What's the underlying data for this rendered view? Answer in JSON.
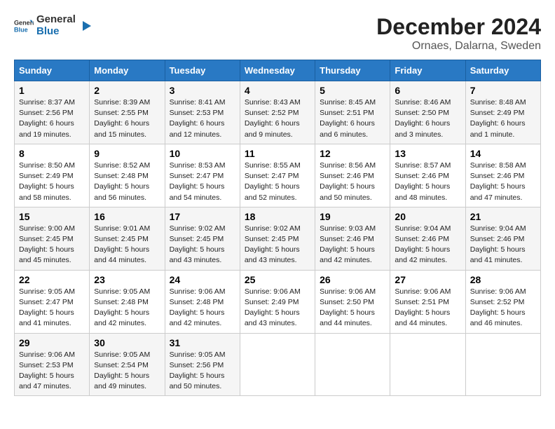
{
  "header": {
    "logo_general": "General",
    "logo_blue": "Blue",
    "title": "December 2024",
    "subtitle": "Ornaes, Dalarna, Sweden"
  },
  "days_of_week": [
    "Sunday",
    "Monday",
    "Tuesday",
    "Wednesday",
    "Thursday",
    "Friday",
    "Saturday"
  ],
  "weeks": [
    [
      {
        "num": "1",
        "sr": "8:37 AM",
        "ss": "2:56 PM",
        "dl": "6 hours and 19 minutes."
      },
      {
        "num": "2",
        "sr": "8:39 AM",
        "ss": "2:55 PM",
        "dl": "6 hours and 15 minutes."
      },
      {
        "num": "3",
        "sr": "8:41 AM",
        "ss": "2:53 PM",
        "dl": "6 hours and 12 minutes."
      },
      {
        "num": "4",
        "sr": "8:43 AM",
        "ss": "2:52 PM",
        "dl": "6 hours and 9 minutes."
      },
      {
        "num": "5",
        "sr": "8:45 AM",
        "ss": "2:51 PM",
        "dl": "6 hours and 6 minutes."
      },
      {
        "num": "6",
        "sr": "8:46 AM",
        "ss": "2:50 PM",
        "dl": "6 hours and 3 minutes."
      },
      {
        "num": "7",
        "sr": "8:48 AM",
        "ss": "2:49 PM",
        "dl": "6 hours and 1 minute."
      }
    ],
    [
      {
        "num": "8",
        "sr": "8:50 AM",
        "ss": "2:49 PM",
        "dl": "5 hours and 58 minutes."
      },
      {
        "num": "9",
        "sr": "8:52 AM",
        "ss": "2:48 PM",
        "dl": "5 hours and 56 minutes."
      },
      {
        "num": "10",
        "sr": "8:53 AM",
        "ss": "2:47 PM",
        "dl": "5 hours and 54 minutes."
      },
      {
        "num": "11",
        "sr": "8:55 AM",
        "ss": "2:47 PM",
        "dl": "5 hours and 52 minutes."
      },
      {
        "num": "12",
        "sr": "8:56 AM",
        "ss": "2:46 PM",
        "dl": "5 hours and 50 minutes."
      },
      {
        "num": "13",
        "sr": "8:57 AM",
        "ss": "2:46 PM",
        "dl": "5 hours and 48 minutes."
      },
      {
        "num": "14",
        "sr": "8:58 AM",
        "ss": "2:46 PM",
        "dl": "5 hours and 47 minutes."
      }
    ],
    [
      {
        "num": "15",
        "sr": "9:00 AM",
        "ss": "2:45 PM",
        "dl": "5 hours and 45 minutes."
      },
      {
        "num": "16",
        "sr": "9:01 AM",
        "ss": "2:45 PM",
        "dl": "5 hours and 44 minutes."
      },
      {
        "num": "17",
        "sr": "9:02 AM",
        "ss": "2:45 PM",
        "dl": "5 hours and 43 minutes."
      },
      {
        "num": "18",
        "sr": "9:02 AM",
        "ss": "2:45 PM",
        "dl": "5 hours and 43 minutes."
      },
      {
        "num": "19",
        "sr": "9:03 AM",
        "ss": "2:46 PM",
        "dl": "5 hours and 42 minutes."
      },
      {
        "num": "20",
        "sr": "9:04 AM",
        "ss": "2:46 PM",
        "dl": "5 hours and 42 minutes."
      },
      {
        "num": "21",
        "sr": "9:04 AM",
        "ss": "2:46 PM",
        "dl": "5 hours and 41 minutes."
      }
    ],
    [
      {
        "num": "22",
        "sr": "9:05 AM",
        "ss": "2:47 PM",
        "dl": "5 hours and 41 minutes."
      },
      {
        "num": "23",
        "sr": "9:05 AM",
        "ss": "2:48 PM",
        "dl": "5 hours and 42 minutes."
      },
      {
        "num": "24",
        "sr": "9:06 AM",
        "ss": "2:48 PM",
        "dl": "5 hours and 42 minutes."
      },
      {
        "num": "25",
        "sr": "9:06 AM",
        "ss": "2:49 PM",
        "dl": "5 hours and 43 minutes."
      },
      {
        "num": "26",
        "sr": "9:06 AM",
        "ss": "2:50 PM",
        "dl": "5 hours and 44 minutes."
      },
      {
        "num": "27",
        "sr": "9:06 AM",
        "ss": "2:51 PM",
        "dl": "5 hours and 44 minutes."
      },
      {
        "num": "28",
        "sr": "9:06 AM",
        "ss": "2:52 PM",
        "dl": "5 hours and 46 minutes."
      }
    ],
    [
      {
        "num": "29",
        "sr": "9:06 AM",
        "ss": "2:53 PM",
        "dl": "5 hours and 47 minutes."
      },
      {
        "num": "30",
        "sr": "9:05 AM",
        "ss": "2:54 PM",
        "dl": "5 hours and 49 minutes."
      },
      {
        "num": "31",
        "sr": "9:05 AM",
        "ss": "2:56 PM",
        "dl": "5 hours and 50 minutes."
      },
      null,
      null,
      null,
      null
    ]
  ],
  "labels": {
    "sunrise": "Sunrise:",
    "sunset": "Sunset:",
    "daylight": "Daylight:"
  }
}
